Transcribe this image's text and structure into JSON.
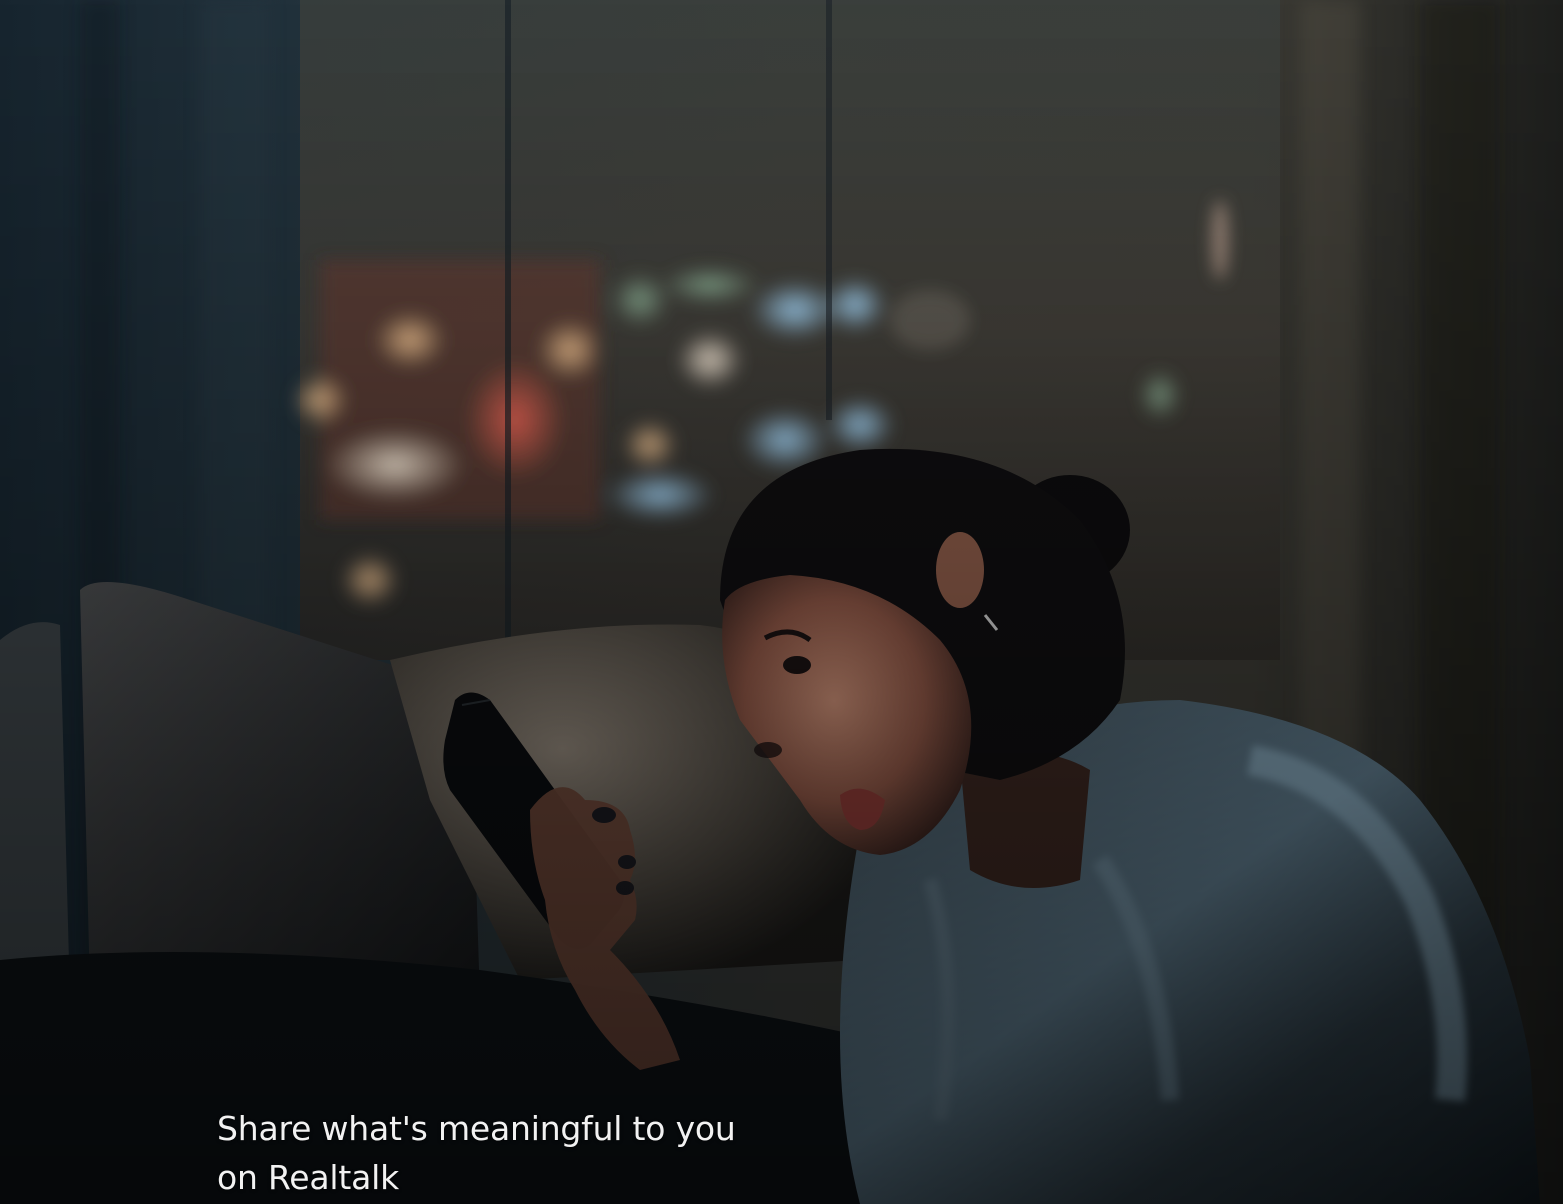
{
  "hero": {
    "caption_line1": "Share what's meaningful to you",
    "caption_line2": "on Realtalk",
    "image_subject": "woman-on-phone-at-night-photo"
  },
  "colors": {
    "caption_text": "#f2f2f2",
    "background_dark": "#0b1116"
  }
}
